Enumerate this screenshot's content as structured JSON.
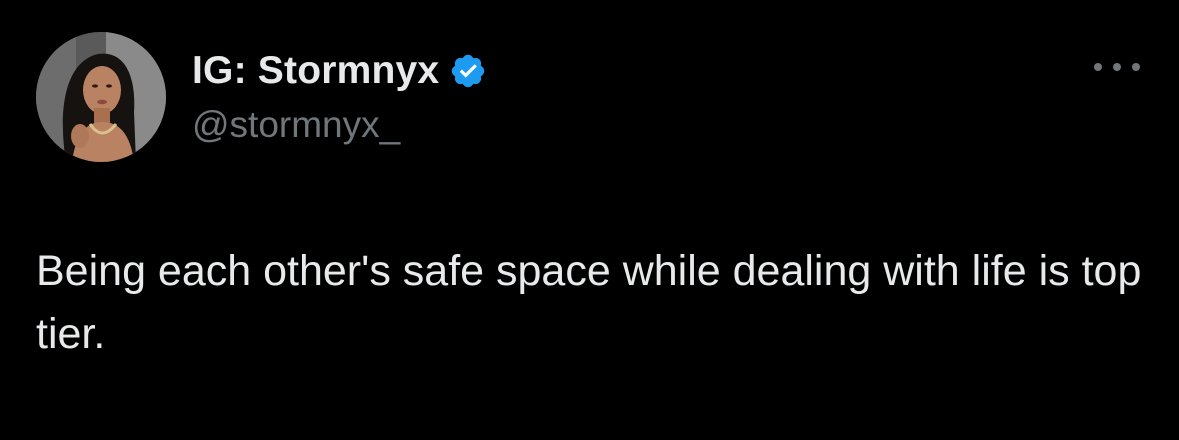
{
  "author": {
    "display_name": "IG: Stormnyx",
    "handle": "@stormnyx_",
    "verified": true,
    "verified_color": "#1d9bf0",
    "avatar_icon": "profile-avatar"
  },
  "menu": {
    "icon": "more-options-icon"
  },
  "tweet": {
    "text": "Being each other's safe space while dealing with life is top tier."
  },
  "theme": {
    "background": "#000000",
    "primary_text": "#e7e9ea",
    "secondary_text": "#71767b"
  }
}
